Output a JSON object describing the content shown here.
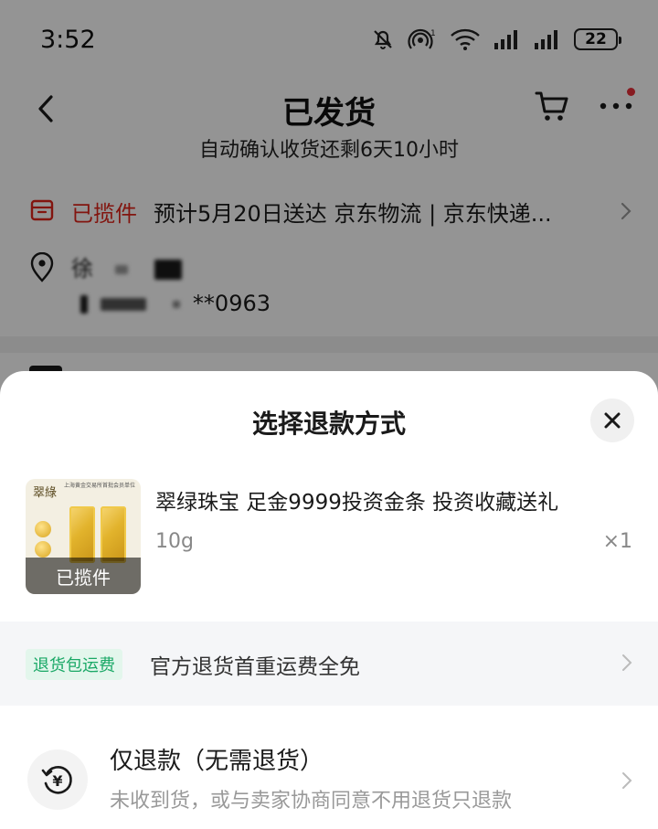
{
  "status_bar": {
    "time": "3:52",
    "battery": "22",
    "icons": [
      "mute-icon",
      "hotspot-icon",
      "wifi-icon",
      "signal-icon",
      "signal-icon",
      "battery-icon"
    ]
  },
  "nav": {
    "title": "已发货",
    "subtitle": "自动确认收货还剩6天10小时"
  },
  "logistics": {
    "status": "已揽件",
    "text": "预计5月20日送达 京东物流 | 京东快递..."
  },
  "address": {
    "line1_prefix": "徐",
    "line2_suffix": "**0963"
  },
  "sheet": {
    "title": "选择退款方式",
    "product": {
      "name": "翠绿珠宝 足金9999投资金条 投资收藏送礼",
      "spec": "10g",
      "qty": "×1",
      "thumb_label": "已揽件",
      "thumb_brand": "翠綠",
      "thumb_header": "上海黄金交易所首批会员单位"
    },
    "promo": {
      "tag": "退货包运费",
      "text": "官方退货首重运费全免"
    },
    "option": {
      "title": "仅退款（无需退货）",
      "subtitle": "未收到货，或与卖家协商同意不用退货只退款",
      "icon_symbol": "¥"
    }
  },
  "colors": {
    "accent_red": "#e1251b",
    "promo_green": "#1aa866",
    "promo_tag_bg": "#e3f6ec"
  }
}
